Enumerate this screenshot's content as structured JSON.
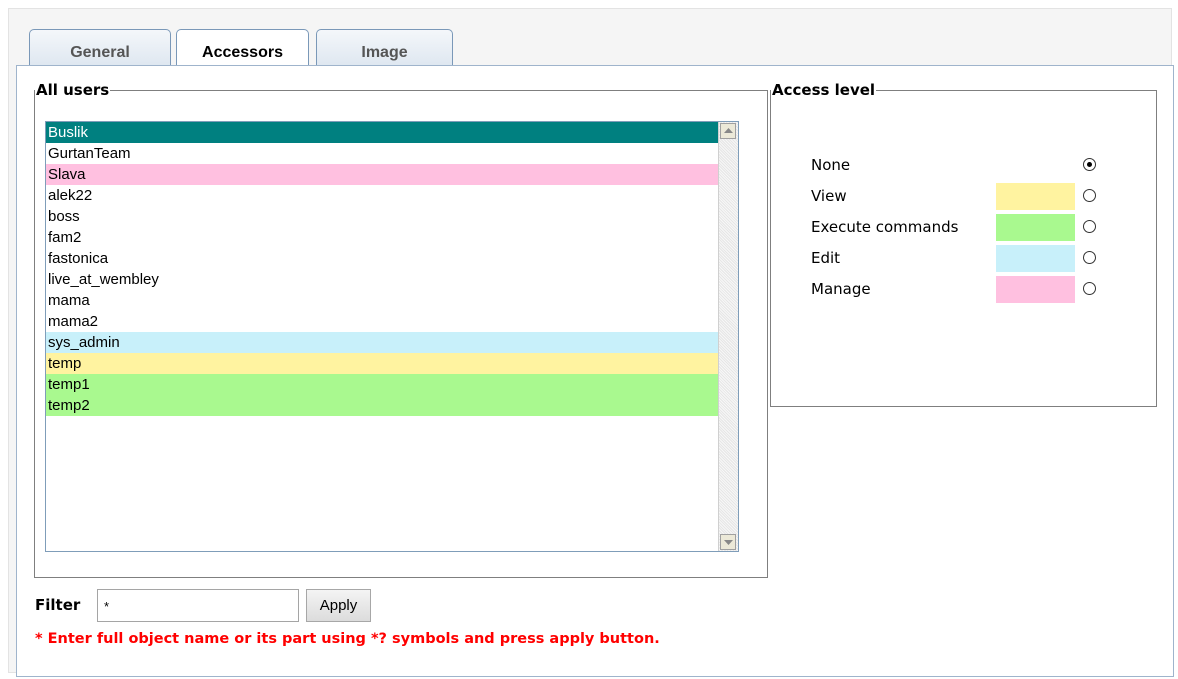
{
  "tabs": [
    {
      "label": "General",
      "active": false
    },
    {
      "label": "Accessors",
      "active": true
    },
    {
      "label": "Image",
      "active": false
    }
  ],
  "users_panel": {
    "legend": "All users",
    "items": [
      {
        "name": "Buslik",
        "color": "#008080",
        "text_color": "#ffffff"
      },
      {
        "name": "GurtanTeam",
        "color": "#ffffff",
        "text_color": "#000000"
      },
      {
        "name": "Slava",
        "color": "#ffc0e0",
        "text_color": "#000000"
      },
      {
        "name": "alek22",
        "color": "#ffffff",
        "text_color": "#000000"
      },
      {
        "name": "boss",
        "color": "#ffffff",
        "text_color": "#000000"
      },
      {
        "name": "fam2",
        "color": "#ffffff",
        "text_color": "#000000"
      },
      {
        "name": "fastonica",
        "color": "#ffffff",
        "text_color": "#000000"
      },
      {
        "name": "live_at_wembley",
        "color": "#ffffff",
        "text_color": "#000000"
      },
      {
        "name": "mama",
        "color": "#ffffff",
        "text_color": "#000000"
      },
      {
        "name": "mama2",
        "color": "#ffffff",
        "text_color": "#000000"
      },
      {
        "name": "sys_admin",
        "color": "#c8f0fa",
        "text_color": "#000000"
      },
      {
        "name": "temp",
        "color": "#fff3a0",
        "text_color": "#000000"
      },
      {
        "name": "temp1",
        "color": "#a9f98f",
        "text_color": "#000000"
      },
      {
        "name": "temp2",
        "color": "#a9f98f",
        "text_color": "#000000"
      }
    ]
  },
  "access_panel": {
    "legend": "Access level",
    "levels": [
      {
        "label": "None",
        "color": "",
        "checked": true
      },
      {
        "label": "View",
        "color": "#fff3a0",
        "checked": false
      },
      {
        "label": "Execute commands",
        "color": "#a9f98f",
        "checked": false
      },
      {
        "label": "Edit",
        "color": "#c8f0fa",
        "checked": false
      },
      {
        "label": "Manage",
        "color": "#ffc0e0",
        "checked": false
      }
    ]
  },
  "filter": {
    "label": "Filter",
    "value": "*",
    "apply_label": "Apply",
    "hint": "* Enter full object name or its part using *? symbols and press apply button."
  },
  "icons": {
    "scroll_up": "chevron-up-icon",
    "scroll_down": "chevron-down-icon"
  }
}
